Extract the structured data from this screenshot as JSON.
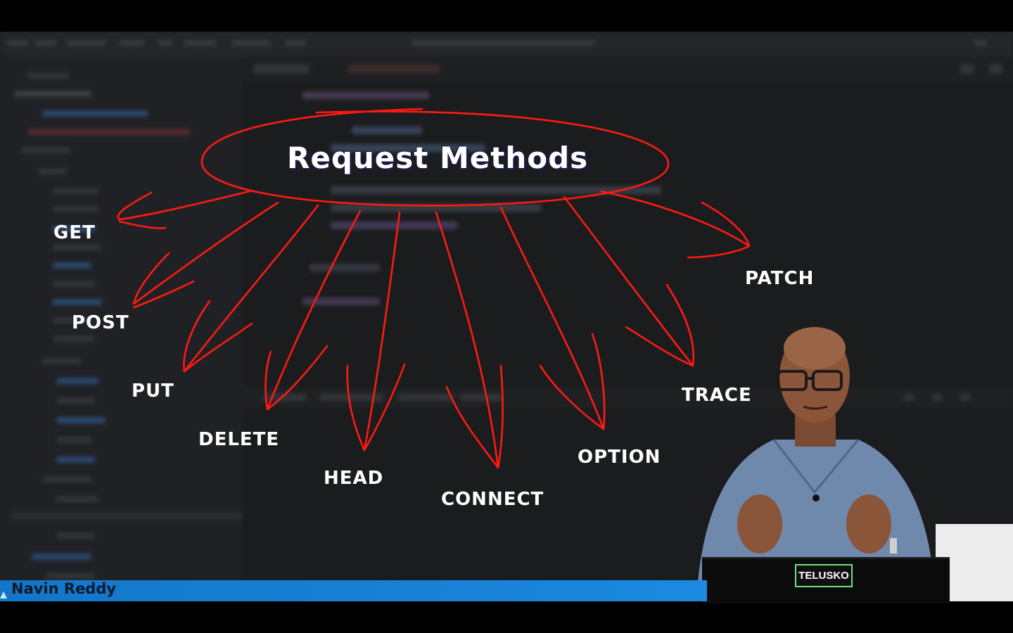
{
  "slide": {
    "title": "Request Methods",
    "methods": [
      "GET",
      "POST",
      "PUT",
      "DELETE",
      "HEAD",
      "CONNECT",
      "OPTION",
      "TRACE",
      "PATCH"
    ]
  },
  "presenter": {
    "name": "Navin Reddy",
    "laptop_label": "TELUSKO"
  },
  "colors": {
    "annotation": "#ff1a12",
    "name_bar": "#1a80d8",
    "badge_border": "#6fe37a"
  }
}
